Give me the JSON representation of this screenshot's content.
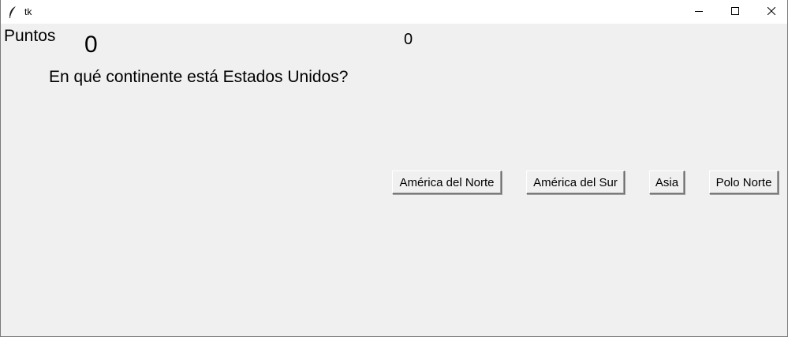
{
  "window": {
    "title": "tk"
  },
  "icons": {
    "app": "feather-icon",
    "minimize": "minimize-icon",
    "maximize": "maximize-icon",
    "close": "close-icon"
  },
  "score": {
    "label": "Puntos",
    "value": "0"
  },
  "counter": {
    "value": "0"
  },
  "question": {
    "text": "En qué continente está Estados Unidos?"
  },
  "answers": [
    {
      "label": "América del Norte"
    },
    {
      "label": "América del Sur"
    },
    {
      "label": "Asia"
    },
    {
      "label": "Polo Norte"
    }
  ],
  "colors": {
    "background": "#f0f0f0",
    "titlebar": "#ffffff",
    "text": "#000000"
  }
}
